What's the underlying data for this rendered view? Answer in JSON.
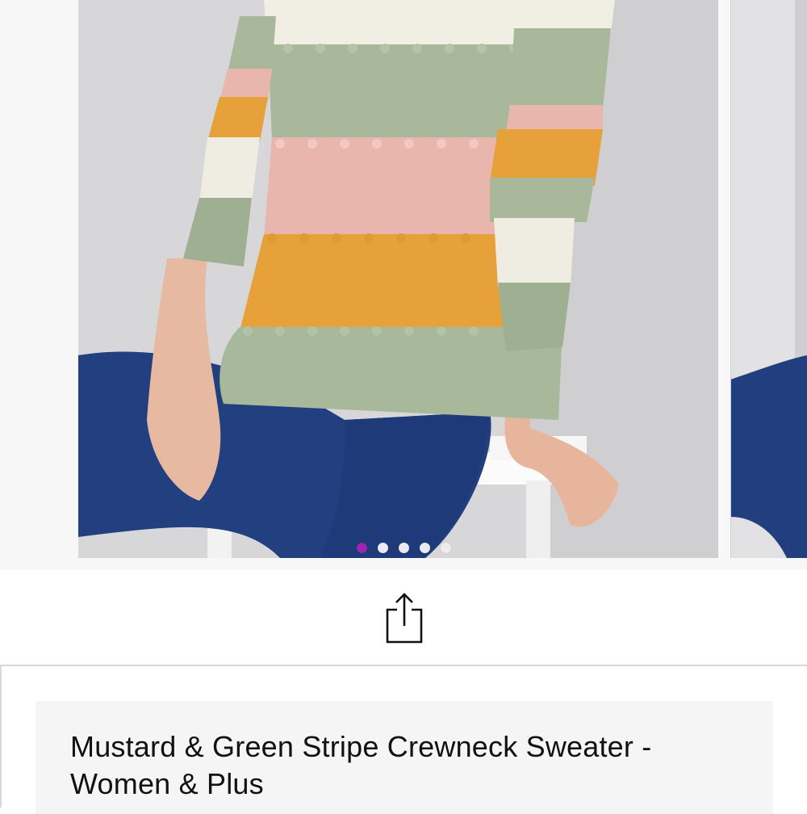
{
  "carousel": {
    "slides": [
      {
        "image": "striped-sweater-model-photo"
      },
      {
        "image": "striped-sweater-model-photo-alt"
      }
    ],
    "dots": [
      {
        "state": "active"
      },
      {
        "state": "inactive"
      },
      {
        "state": "inactive"
      },
      {
        "state": "inactive"
      },
      {
        "state": "inactive"
      }
    ],
    "active_dot_color": "#9b26b6"
  },
  "actions": {
    "share_icon": "share-icon"
  },
  "product": {
    "title": "Mustard & Green Stripe Crewneck Sweater - Women & Plus"
  }
}
